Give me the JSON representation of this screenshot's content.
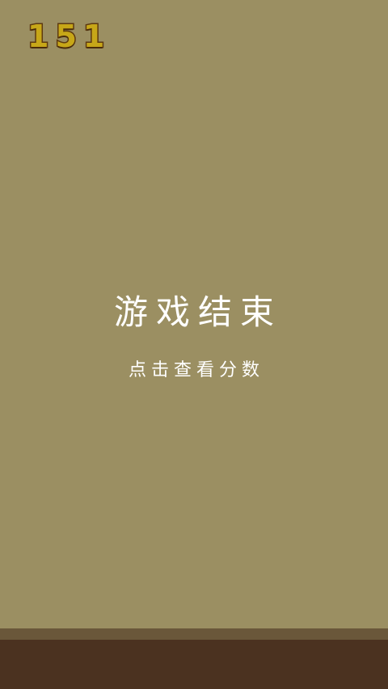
{
  "hud": {
    "score": "151"
  },
  "overlay": {
    "title": "游戏结束",
    "subtitle": "点击查看分数"
  },
  "colors": {
    "background": "#9b8f62",
    "score_fill": "#c7a718",
    "score_outline": "#5e3a10",
    "ground_top": "#6a573a",
    "ground": "#4b3220",
    "text": "#ffffff"
  }
}
